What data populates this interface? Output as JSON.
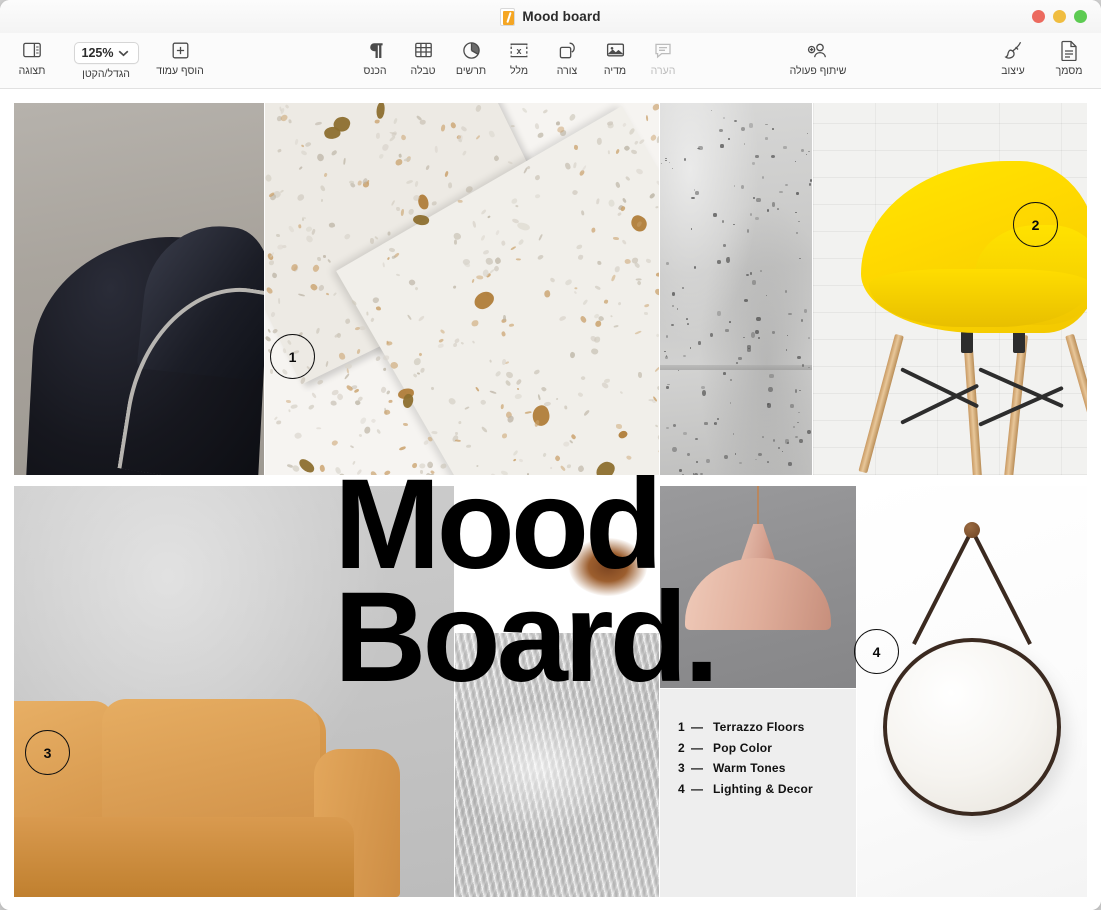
{
  "window": {
    "title": "Mood board",
    "doc_icon": "pages-document-icon",
    "controls": [
      {
        "name": "close-button",
        "color": "#ec6a5f"
      },
      {
        "name": "minimize-button",
        "color": "#f0bd40"
      },
      {
        "name": "zoom-button",
        "color": "#5dcb52"
      }
    ]
  },
  "toolbar": {
    "left_group": [
      {
        "key": "document",
        "label": "מסמך",
        "icon": "document-icon",
        "disabled": false
      },
      {
        "key": "format",
        "label": "עיצוב",
        "icon": "paintbrush-icon",
        "disabled": false
      }
    ],
    "collaborate": {
      "key": "collaborate",
      "label": "שיתוף פעולה",
      "icon": "add-person-icon",
      "disabled": false
    },
    "insert_group": [
      {
        "key": "comment",
        "label": "הערה",
        "icon": "comment-icon",
        "disabled": true
      },
      {
        "key": "media",
        "label": "מדיה",
        "icon": "media-image-icon",
        "disabled": false
      },
      {
        "key": "shape",
        "label": "צורה",
        "icon": "shape-icon",
        "disabled": false
      },
      {
        "key": "text",
        "label": "מלל",
        "icon": "text-box-icon",
        "disabled": false
      },
      {
        "key": "chart",
        "label": "תרשים",
        "icon": "pie-chart-icon",
        "disabled": false
      },
      {
        "key": "table",
        "label": "טבלה",
        "icon": "table-grid-icon",
        "disabled": false
      },
      {
        "key": "insert",
        "label": "הכנס",
        "icon": "pilcrow-icon",
        "disabled": false
      }
    ],
    "right_group": [
      {
        "key": "add_page",
        "label": "הוסף עמוד",
        "icon": "plus-box-icon",
        "disabled": false
      }
    ],
    "zoom": {
      "label": "הגדל/הקטן",
      "value": "125%",
      "icon": "chevron-down-icon"
    },
    "view": {
      "label": "תצוגה",
      "icon": "sidebar-view-icon"
    }
  },
  "document": {
    "headline_line1": "Mood",
    "headline_line2": "Board.",
    "badges": [
      {
        "number": "1",
        "target": "terrazzo-tile"
      },
      {
        "number": "2",
        "target": "yellow-chair-tile"
      },
      {
        "number": "3",
        "target": "sofa-tile"
      },
      {
        "number": "4",
        "target": "lamp-tile"
      }
    ],
    "legend": {
      "dash": "—",
      "items": [
        {
          "num": "1",
          "label": "Terrazzo Floors"
        },
        {
          "num": "2",
          "label": "Pop Color"
        },
        {
          "num": "3",
          "label": "Warm Tones"
        },
        {
          "num": "4",
          "label": "Lighting & Decor"
        }
      ]
    },
    "images": [
      {
        "name": "dark-leather-chair-photo",
        "alt": "Dark navy leather armchair against warm grey wall"
      },
      {
        "name": "terrazzo-slab-photo",
        "alt": "White terrazzo slabs with amber and purple chips"
      },
      {
        "name": "concrete-texture-photo",
        "alt": "Grey concrete wall texture strip"
      },
      {
        "name": "yellow-chair-photo",
        "alt": "Yellow moulded chair with wooden legs on white brick wall"
      },
      {
        "name": "tan-leather-sofa-photo",
        "alt": "Camel tan leather sofa against grey plaster wall"
      },
      {
        "name": "wood-grain-photo",
        "alt": "Warm wood grain texture with knot"
      },
      {
        "name": "grey-fur-rug-photo",
        "alt": "Grey sheepskin fur rug texture"
      },
      {
        "name": "pendant-lamp-photo",
        "alt": "Blush pink pendant lamp on grey wall"
      },
      {
        "name": "round-mirror-photo",
        "alt": "Round mirror with leather hanging strap on white wall"
      }
    ],
    "colors": {
      "accent_yellow": "#ffdd00",
      "warm_tan": "#d3954a",
      "blush": "#e0ae9b",
      "charcoal": "#16171e",
      "legend_bg": "#eeeeee"
    }
  }
}
